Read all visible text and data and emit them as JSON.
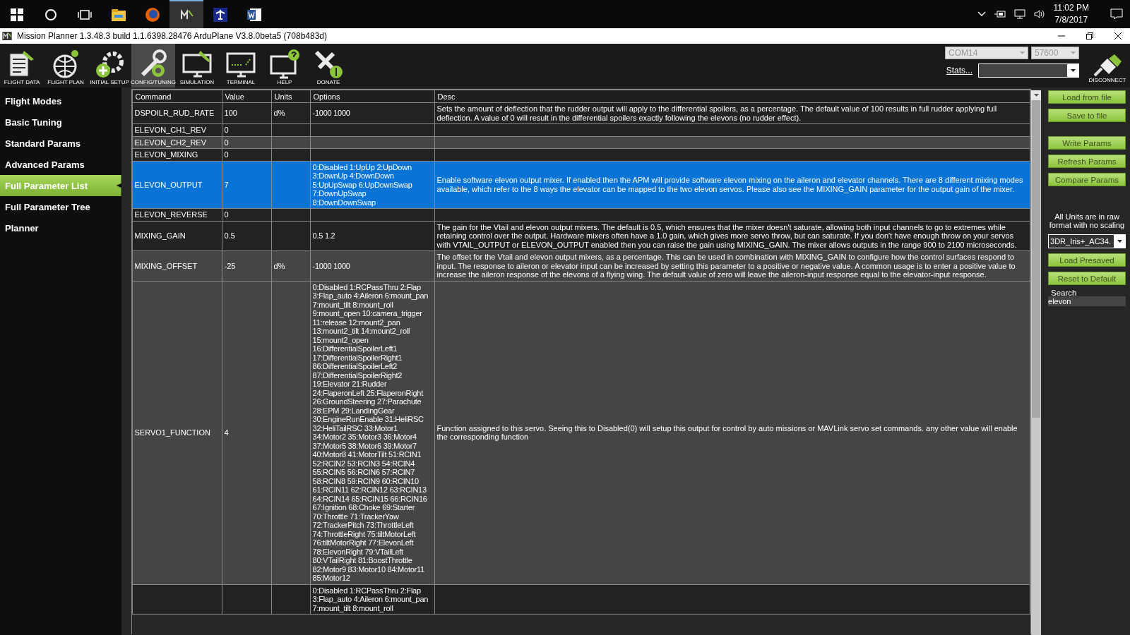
{
  "taskbar": {
    "apps": [
      {
        "kind": "explorer",
        "selected": false
      },
      {
        "kind": "firefox",
        "selected": false
      },
      {
        "kind": "mp",
        "selected": true
      },
      {
        "kind": "plane",
        "selected": false
      },
      {
        "kind": "word",
        "selected": false
      }
    ],
    "time": "11:02 PM",
    "date": "7/8/2017"
  },
  "window": {
    "title": "Mission Planner 1.3.48.3 build 1.1.6398.28476 ArduPlane V3.8.0beta5 (708b483d)"
  },
  "toolbar": {
    "items": [
      {
        "label": "FLIGHT DATA",
        "kind": "data",
        "selected": false
      },
      {
        "label": "FLIGHT PLAN",
        "kind": "plan",
        "selected": false
      },
      {
        "label": "INITIAL SETUP",
        "kind": "setup",
        "selected": false
      },
      {
        "label": "CONFIG/TUNING",
        "kind": "config",
        "selected": true
      },
      {
        "label": "SIMULATION",
        "kind": "sim",
        "selected": false
      },
      {
        "label": "TERMINAL",
        "kind": "terminal",
        "selected": false
      },
      {
        "label": "HELP",
        "kind": "help",
        "selected": false
      },
      {
        "label": "DONATE",
        "kind": "donate",
        "selected": false
      }
    ],
    "port": "COM14",
    "baud": "57600",
    "stats_link": "Stats...",
    "disconnect": "DISCONNECT"
  },
  "sidebar": {
    "items": [
      {
        "label": "Flight Modes",
        "selected": false
      },
      {
        "label": "Basic Tuning",
        "selected": false
      },
      {
        "label": "Standard Params",
        "selected": false
      },
      {
        "label": "Advanced Params",
        "selected": false
      },
      {
        "label": "Full Parameter List",
        "selected": true
      },
      {
        "label": "Full Parameter Tree",
        "selected": false
      },
      {
        "label": "Planner",
        "selected": false
      }
    ]
  },
  "table": {
    "columns": [
      "Command",
      "Value",
      "Units",
      "Options",
      "Desc"
    ],
    "rows": [
      {
        "command": "DSPOILR_RUD_RATE",
        "value": "100",
        "units": "d%",
        "options": [
          "-1000 1000"
        ],
        "desc": "Sets the amount of deflection that the rudder output will apply to the differential spoilers, as a percentage. The default value of 100 results in full rudder applying full deflection. A value of 0 will result in the differential spoilers exactly following the elevons (no rudder effect).",
        "selected": false,
        "highlighted": false
      },
      {
        "command": "ELEVON_CH1_REV",
        "value": "0",
        "selected": false,
        "highlighted": false
      },
      {
        "command": "ELEVON_CH2_REV",
        "value": "0",
        "selected": false,
        "highlighted": true
      },
      {
        "command": "ELEVON_MIXING",
        "value": "0",
        "selected": false,
        "highlighted": false
      },
      {
        "command": "ELEVON_OUTPUT",
        "value": "7",
        "options": [
          "0:Disabled 1:UpUp 2:UpDown",
          "3:DownUp 4:DownDown",
          "5:UpUpSwap 6:UpDownSwap",
          "7:DownUpSwap",
          "8:DownDownSwap"
        ],
        "desc": "Enable software elevon output mixer. If enabled then the APM will provide software elevon mixing on the aileron and elevator channels. There are 8 different mixing modes available, which refer to the 8 ways the elevator can be mapped to the two elevon servos. Please also see the MIXING_GAIN parameter for the output gain of the mixer.",
        "selected": true
      },
      {
        "command": "ELEVON_REVERSE",
        "value": "0",
        "selected": false,
        "highlighted": false
      },
      {
        "command": "MIXING_GAIN",
        "value": "0.5",
        "options": [
          "0.5 1.2"
        ],
        "desc": "The gain for the Vtail and elevon output mixers. The default is 0.5, which ensures that the mixer doesn't saturate, allowing both input channels to go to extremes while retaining control over the output. Hardware mixers often have a 1.0 gain, which gives more servo throw, but can saturate. If you don't have enough throw on your servos with VTAIL_OUTPUT or ELEVON_OUTPUT enabled then you can raise the gain using MIXING_GAIN. The mixer allows outputs in the range 900 to 2100 microseconds.",
        "selected": false,
        "highlighted": false
      },
      {
        "command": "MIXING_OFFSET",
        "value": "-25",
        "units": "d%",
        "options": [
          "-1000 1000"
        ],
        "desc": "The offset for the Vtail and elevon output mixers, as a percentage. This can be used in combination with MIXING_GAIN to configure how the control surfaces respond to input. The response to aileron or elevator input can be increased by setting this parameter to a positive or negative value. A common usage is to enter a positive value to increase the aileron response of the elevons of a flying wing. The default value of zero will leave the aileron-input response equal to the elevator-input response.",
        "selected": false,
        "highlighted": true
      },
      {
        "command": "SERVO1_FUNCTION",
        "value": "4",
        "options": [
          "0:Disabled 1:RCPassThru 2:Flap",
          "3:Flap_auto 4:Aileron 6:mount_pan",
          "7:mount_tilt 8:mount_roll",
          "9:mount_open 10:camera_trigger",
          "11:release 12:mount2_pan",
          "13:mount2_tilt 14:mount2_roll",
          "15:mount2_open",
          "16:DifferentialSpoilerLeft1",
          "17:DifferentialSpoilerRight1",
          "86:DifferentialSpoilerLeft2",
          "87:DifferentialSpoilerRight2",
          "19:Elevator 21:Rudder",
          "24:FlaperonLeft 25:FlaperonRight",
          "26:GroundSteering 27:Parachute",
          "28:EPM 29:LandingGear",
          "30:EngineRunEnable 31:HeliRSC",
          "32:HeliTailRSC 33:Motor1",
          "34:Motor2 35:Motor3 36:Motor4",
          "37:Motor5 38:Motor6 39:Motor7",
          "40:Motor8 41:MotorTilt 51:RCIN1",
          "52:RCIN2 53:RCIN3 54:RCIN4",
          "55:RCIN5 56:RCIN6 57:RCIN7",
          "58:RCIN8 59:RCIN9 60:RCIN10",
          "61:RCIN11 62:RCIN12 63:RCIN13",
          "64:RCIN14 65:RCIN15 66:RCIN16",
          "67:Ignition 68:Choke 69:Starter",
          "70:Throttle 71:TrackerYaw",
          "72:TrackerPitch 73:ThrottleLeft",
          "74:ThrottleRight 75:tiltMotorLeft",
          "76:tiltMotorRight 77:ElevonLeft",
          "78:ElevonRight 79:VTailLeft",
          "80:VTailRight 81:BoostThrottle",
          "82:Motor9 83:Motor10 84:Motor11",
          "85:Motor12"
        ],
        "desc": "Function assigned to this servo. Seeing this to Disabled(0) will setup this output for control by auto missions or MAVLink servo set commands. any other value will enable the corresponding function",
        "selected": false,
        "highlighted": true
      },
      {
        "options": [
          "0:Disabled 1:RCPassThru 2:Flap",
          "3:Flap_auto 4:Aileron 6:mount_pan",
          "7:mount_tilt 8:mount_roll"
        ],
        "selected": false,
        "highlighted": false
      }
    ]
  },
  "panel": {
    "buttons_top": [
      "Load from file",
      "Save to file"
    ],
    "buttons_params": [
      "Write Params",
      "Refresh Params",
      "Compare Params"
    ],
    "note": "All Units are in raw format with no scaling",
    "preset": "3DR_Iris+_AC34.",
    "buttons_bottom": [
      "Load Presaved",
      "Reset to Default"
    ],
    "search_label": "Search",
    "search_value": "elevon"
  }
}
